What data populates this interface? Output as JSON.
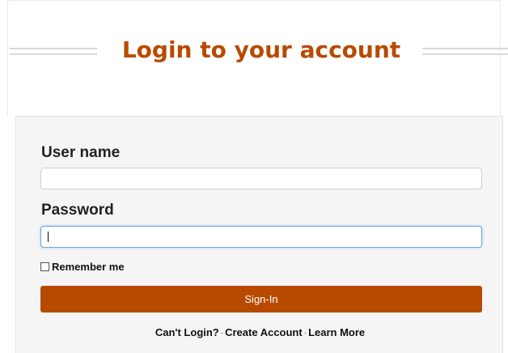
{
  "header": {
    "title": "Login to your account"
  },
  "form": {
    "username_label": "User name",
    "username_value": "",
    "password_label": "Password",
    "password_value": "",
    "remember_label": "Remember me",
    "remember_checked": false,
    "signin_label": "Sign-In"
  },
  "links": {
    "cant_login": "Can't Login?",
    "separator": "·",
    "create_account": "Create Account",
    "learn_more": "Learn More"
  },
  "colors": {
    "accent": "#b84a00",
    "panel_background": "#f5f5f5",
    "focus_border": "#6aa9e0"
  }
}
